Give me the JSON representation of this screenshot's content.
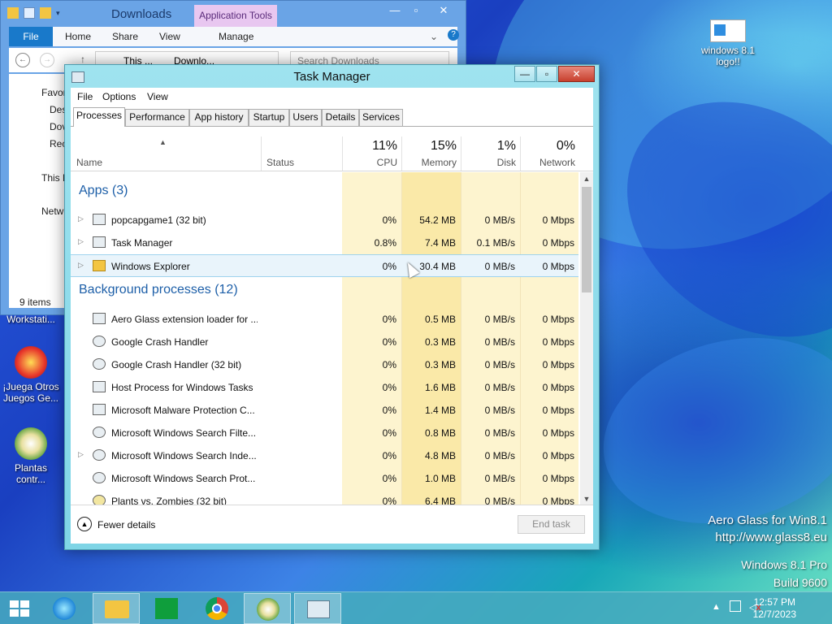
{
  "desktop": {
    "icons": [
      {
        "label": "windows 8.1 logo!!"
      },
      {
        "label": "Workstati..."
      },
      {
        "label": "¡Juega Otros Juegos Ge..."
      },
      {
        "label": "Plantas contr..."
      }
    ],
    "watermark": {
      "line1": "Aero Glass for Win8.1",
      "line2": "http://www.glass8.eu",
      "line3": "Windows 8.1 Pro",
      "line4": "Build 9600"
    }
  },
  "explorer": {
    "title": "Downloads",
    "contextual_tab": "Application Tools",
    "ribbon_tabs": [
      "File",
      "Home",
      "Share",
      "View",
      "Manage"
    ],
    "address": {
      "part1": "This ...",
      "part2": "Downlo..."
    },
    "search_placeholder": "Search Downloads",
    "nav_items": [
      "Favor",
      "Des",
      "Dov",
      "Rec",
      "This P",
      "Netw"
    ],
    "status": "9 items"
  },
  "taskmanager": {
    "title": "Task Manager",
    "menu": [
      "File",
      "Options",
      "View"
    ],
    "tabs": [
      "Processes",
      "Performance",
      "App history",
      "Startup",
      "Users",
      "Details",
      "Services"
    ],
    "columns": {
      "name": "Name",
      "status": "Status",
      "cpu": {
        "pct": "11%",
        "label": "CPU"
      },
      "memory": {
        "pct": "15%",
        "label": "Memory"
      },
      "disk": {
        "pct": "1%",
        "label": "Disk"
      },
      "network": {
        "pct": "0%",
        "label": "Network"
      }
    },
    "groups": {
      "apps": "Apps (3)",
      "background": "Background processes (12)"
    },
    "apps": [
      {
        "name": "popcapgame1 (32 bit)",
        "cpu": "0%",
        "memory": "54.2 MB",
        "disk": "0 MB/s",
        "network": "0 Mbps"
      },
      {
        "name": "Task Manager",
        "cpu": "0.8%",
        "memory": "7.4 MB",
        "disk": "0.1 MB/s",
        "network": "0 Mbps"
      },
      {
        "name": "Windows Explorer",
        "cpu": "0%",
        "memory": "30.4 MB",
        "disk": "0 MB/s",
        "network": "0 Mbps"
      }
    ],
    "background": [
      {
        "name": "Aero Glass extension loader for ...",
        "cpu": "0%",
        "memory": "0.5 MB",
        "disk": "0 MB/s",
        "network": "0 Mbps"
      },
      {
        "name": "Google Crash Handler",
        "cpu": "0%",
        "memory": "0.3 MB",
        "disk": "0 MB/s",
        "network": "0 Mbps"
      },
      {
        "name": "Google Crash Handler (32 bit)",
        "cpu": "0%",
        "memory": "0.3 MB",
        "disk": "0 MB/s",
        "network": "0 Mbps"
      },
      {
        "name": "Host Process for Windows Tasks",
        "cpu": "0%",
        "memory": "1.6 MB",
        "disk": "0 MB/s",
        "network": "0 Mbps"
      },
      {
        "name": "Microsoft Malware Protection C...",
        "cpu": "0%",
        "memory": "1.4 MB",
        "disk": "0 MB/s",
        "network": "0 Mbps"
      },
      {
        "name": "Microsoft Windows Search Filte...",
        "cpu": "0%",
        "memory": "0.8 MB",
        "disk": "0 MB/s",
        "network": "0 Mbps"
      },
      {
        "name": "Microsoft Windows Search Inde...",
        "cpu": "0%",
        "memory": "4.8 MB",
        "disk": "0 MB/s",
        "network": "0 Mbps"
      },
      {
        "name": "Microsoft Windows Search Prot...",
        "cpu": "0%",
        "memory": "1.0 MB",
        "disk": "0 MB/s",
        "network": "0 Mbps"
      },
      {
        "name": "Plants vs. Zombies (32 bit)",
        "cpu": "0%",
        "memory": "6.4 MB",
        "disk": "0 MB/s",
        "network": "0 Mbps"
      }
    ],
    "footer": {
      "fewer": "Fewer details",
      "end_task": "End task"
    },
    "colors": {
      "heat_light": "#fdf3c8",
      "heat_mid": "#f9e8a6",
      "selection": "#e9f4fb",
      "group_text": "#1d5fa8"
    }
  },
  "taskbar": {
    "time": "12:57 PM",
    "date": "12/7/2023",
    "items": [
      "start-button",
      "internet-explorer",
      "file-explorer",
      "store",
      "chrome",
      "plants-vs-zombies",
      "task-manager"
    ]
  }
}
